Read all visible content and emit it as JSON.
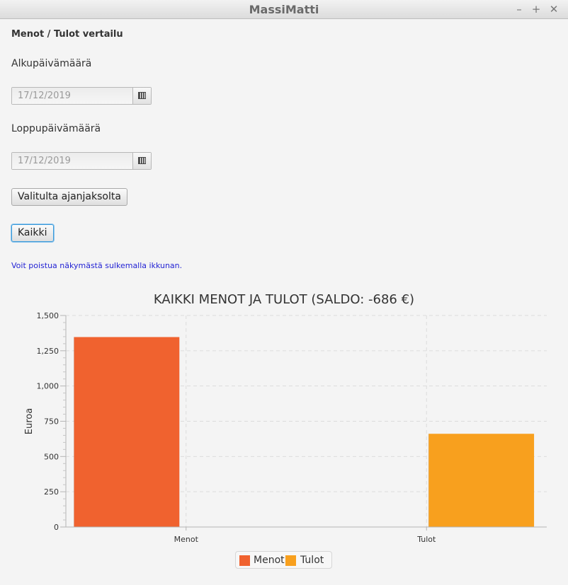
{
  "window": {
    "title": "MassiMatti",
    "minimize": "–",
    "maximize": "+",
    "close": "✕"
  },
  "form": {
    "heading": "Menot / Tulot vertailu",
    "start_label": "Alkupäivämäärä",
    "start_value": "17/12/2019",
    "end_label": "Loppupäivämäärä",
    "end_value": "17/12/2019",
    "calendar_icon": "calendar-icon",
    "period_button": "Valitulta ajanjaksolta",
    "all_button": "Kaikki",
    "hint": "Voit poistua näkymästä sulkemalla ikkunan."
  },
  "chart_data": {
    "type": "bar",
    "title": "KAIKKI MENOT JA TULOT (SALDO: -686 €)",
    "xlabel": "",
    "ylabel": "Euroa",
    "categories": [
      "Menot",
      "Tulot"
    ],
    "series": [
      {
        "name": "Menot",
        "color": "#f0622f",
        "values": [
          1347,
          null
        ]
      },
      {
        "name": "Tulot",
        "color": "#f8a01e",
        "values": [
          null,
          661
        ]
      }
    ],
    "ylim": [
      0,
      1500
    ],
    "yticks": [
      0,
      250,
      500,
      750,
      1000,
      1250,
      1500
    ],
    "ytick_labels": [
      "0",
      "250",
      "500",
      "750",
      "1,000",
      "1,250",
      "1,500"
    ],
    "grid": true,
    "legend_position": "bottom"
  }
}
